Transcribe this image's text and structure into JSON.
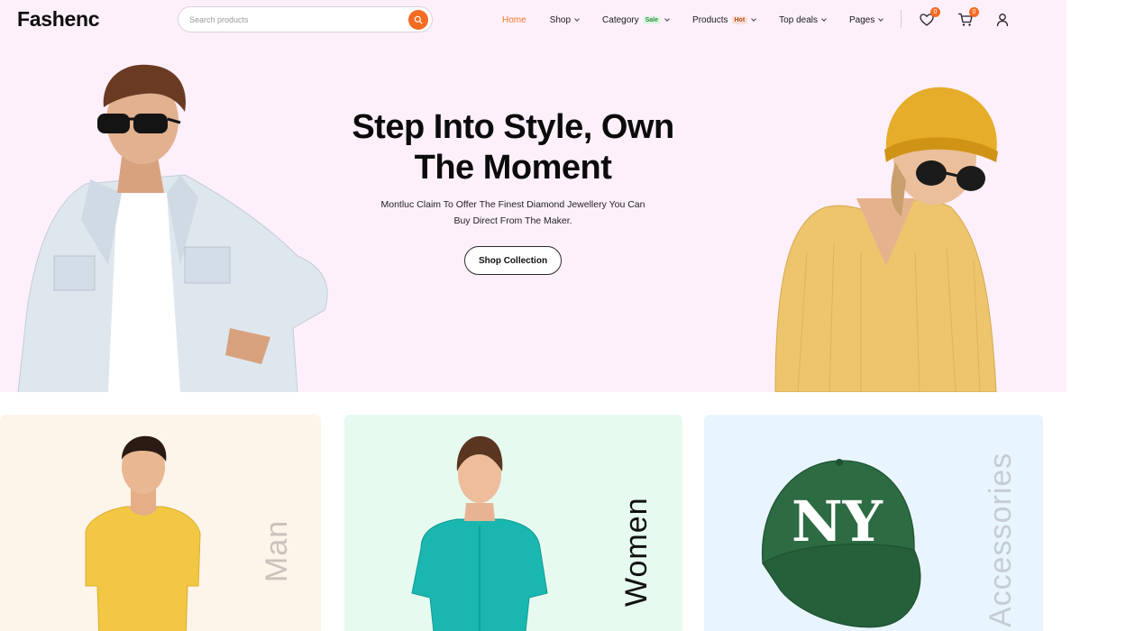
{
  "header": {
    "logo": "Fashenc",
    "search": {
      "placeholder": "Search products",
      "value": ""
    },
    "nav": [
      {
        "label": "Home",
        "active": true,
        "dropdown": false,
        "tag": ""
      },
      {
        "label": "Shop",
        "active": false,
        "dropdown": true,
        "tag": ""
      },
      {
        "label": "Category",
        "active": false,
        "dropdown": true,
        "tag": "Sale"
      },
      {
        "label": "Products",
        "active": false,
        "dropdown": true,
        "tag": "Hot"
      },
      {
        "label": "Top deals",
        "active": false,
        "dropdown": true,
        "tag": ""
      },
      {
        "label": "Pages",
        "active": false,
        "dropdown": true,
        "tag": ""
      }
    ],
    "wishlist_count": "0",
    "cart_count": "0",
    "icons": [
      "search-icon",
      "heart-icon",
      "cart-icon",
      "user-icon"
    ]
  },
  "hero": {
    "title_line1": "Step Into Style, Own",
    "title_line2": "The Moment",
    "subtitle_line1": "Montluc Claim To Offer The Finest Diamond Jewellery You Can",
    "subtitle_line2": "Buy Direct From The Maker.",
    "cta": "Shop Collection"
  },
  "categories": [
    {
      "label": "Man"
    },
    {
      "label": "Women"
    },
    {
      "label": "Accessories"
    }
  ],
  "colors": {
    "accent": "#f56b22",
    "active_nav": "#f37a2a",
    "hero_bg": "#fdf0fb",
    "man_card_bg": "#fdf4ea",
    "women_card_bg": "#e6faf0",
    "accessories_card_bg": "#e9f5fe"
  }
}
